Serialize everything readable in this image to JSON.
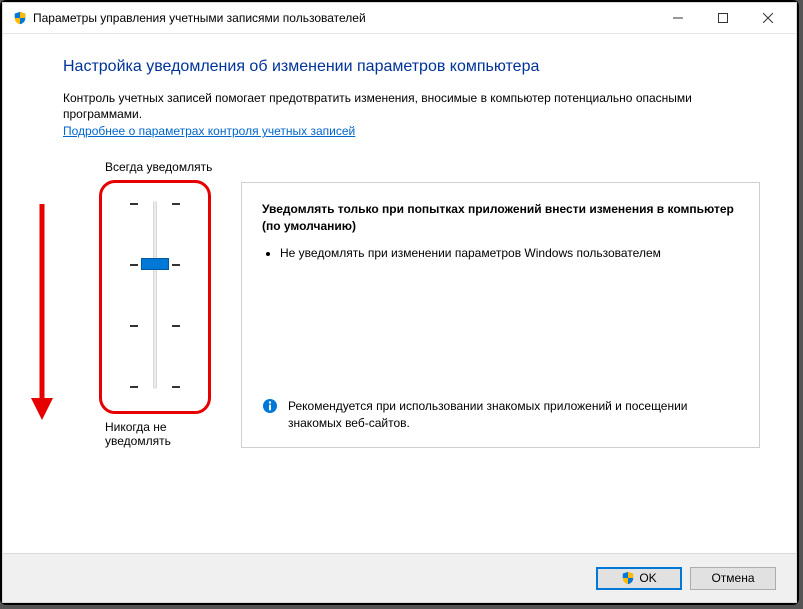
{
  "window": {
    "title": "Параметры управления учетными записями пользователей"
  },
  "heading": "Настройка уведомления об изменении параметров компьютера",
  "intro": "Контроль учетных записей помогает предотвратить изменения, вносимые в компьютер потенциально опасными программами.",
  "link": "Подробнее о параметрах контроля учетных записей",
  "slider": {
    "top_label": "Всегда уведомлять",
    "bottom_label": "Никогда не уведомлять",
    "levels": 4,
    "selected_index": 1
  },
  "desc": {
    "title": "Уведомлять только при попытках приложений внести изменения в компьютер (по умолчанию)",
    "bullet": "Не уведомлять при изменении параметров Windows пользователем",
    "recommendation": "Рекомендуется при использовании знакомых приложений и посещении знакомых веб-сайтов."
  },
  "buttons": {
    "ok": "OK",
    "cancel": "Отмена"
  }
}
